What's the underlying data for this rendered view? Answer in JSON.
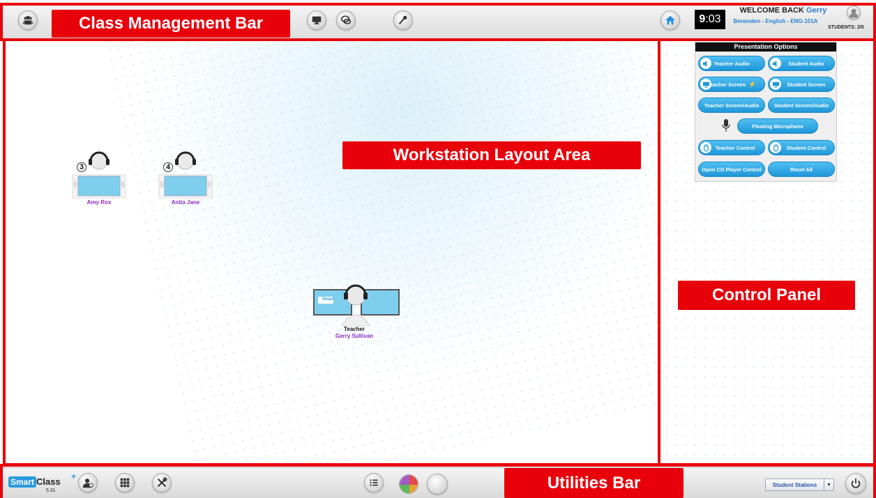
{
  "header": {
    "clock_hour": "9",
    "clock_min": ":03",
    "welcome_prefix": "WELCOME BACK",
    "user_name": "Gerry",
    "course": "Benenden - English - ENG-101A",
    "students_count": "STUDENTS: 2/0"
  },
  "annotations": {
    "class_management_bar": "Class Management Bar",
    "workstation_layout_area": "Workstation Layout Area",
    "control_panel": "Control Panel",
    "utilities_bar": "Utilities Bar"
  },
  "workstations": [
    {
      "number": "3",
      "name": "Amy Rox"
    },
    {
      "number": "4",
      "name": "Anita Jane"
    }
  ],
  "teacher": {
    "title": "Teacher",
    "name": "Gerry Sullivan",
    "screen_logo": "Smart"
  },
  "presentation_options": {
    "title": "Presentation Options",
    "teacher_audio": "Teacher Audio",
    "student_audio": "Student Audio",
    "teacher_screen": "Teacher Screen",
    "student_screen": "Student Screen",
    "teacher_screen_audio": "Teacher Screen/Audio",
    "student_screen_audio": "Student Screen/Audio",
    "floating_microphone": "Floating Microphone",
    "teacher_control": "Teacher Control",
    "student_control": "Student Control",
    "open_cd_player": "Open CD Player Control",
    "reset_all": "Reset All"
  },
  "footer": {
    "logo_smart": "Smart",
    "logo_class": "Class",
    "logo_plus": "+",
    "version": "5.31",
    "stations_select": "Student Stations"
  },
  "colors": {
    "annotation_red": "#e8000b",
    "button_blue": "#1f96d8",
    "student_name": "#8a2bc7"
  }
}
